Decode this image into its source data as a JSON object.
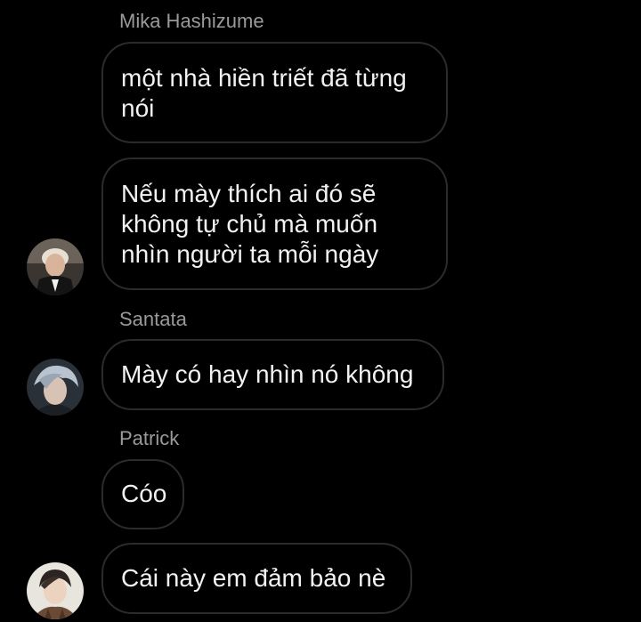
{
  "messages": [
    {
      "sender": "Mika Hashizume",
      "lines": [
        "một nhà hiền triết đã từng",
        "nói"
      ]
    },
    {
      "lines": [
        "Nếu mày thích ai đó sẽ",
        "không tự chủ mà muốn",
        "nhìn người ta mỗi ngày"
      ],
      "avatar": "user-avatar-mika"
    },
    {
      "sender": "Santata",
      "lines": [
        "Mày có hay nhìn nó không"
      ],
      "avatar": "user-avatar-santata"
    },
    {
      "sender": "Patrick",
      "lines": [
        "Cóo"
      ]
    },
    {
      "lines": [
        "Cái này em đảm bảo nè"
      ],
      "avatar": "user-avatar-patrick"
    }
  ],
  "colors": {
    "background": "#000000",
    "bubble_border": "#2b2b2b",
    "sender_name": "#9a9a9a",
    "text": "#f2f2f2"
  }
}
